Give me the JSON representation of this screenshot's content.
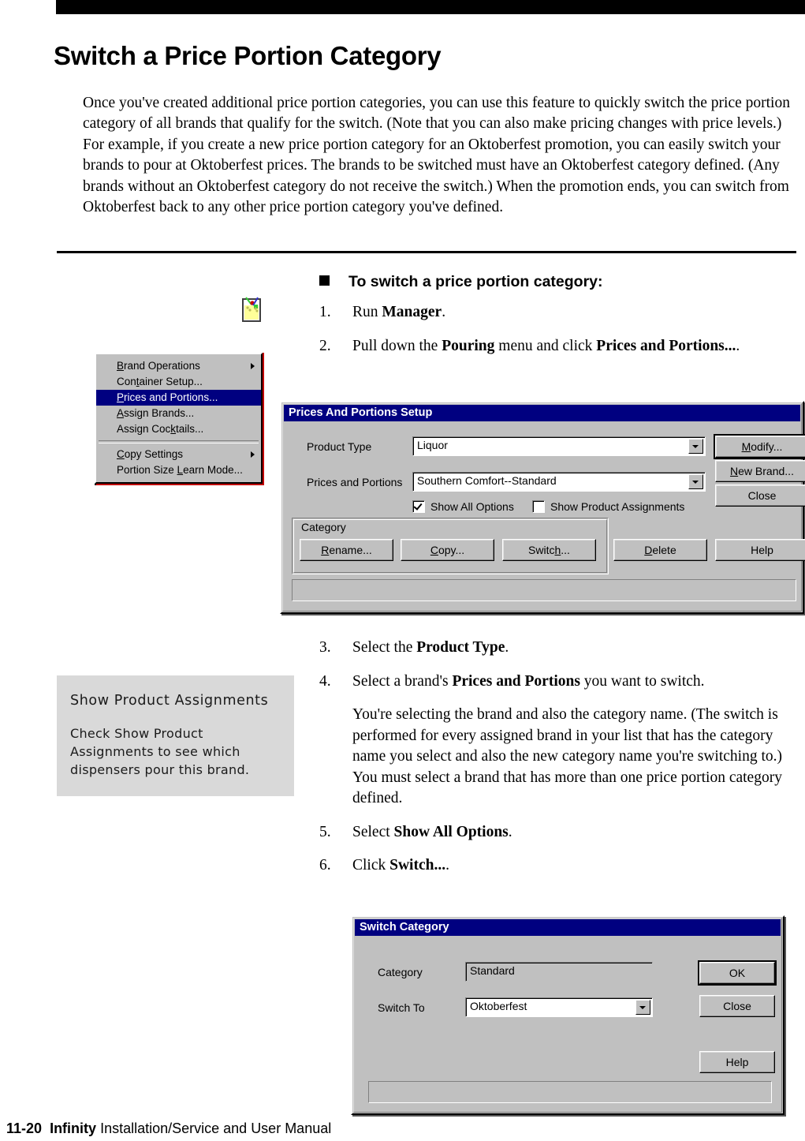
{
  "page": {
    "title": "Switch a Price Portion Category",
    "intro": "Once you've created additional price portion categories, you can use this feature to quickly switch the price portion category of all brands that qualify for the switch. (Note that you can also make pricing changes with price levels.) For example, if you create a new price portion category for an Oktoberfest promotion, you can easily switch your brands to pour at Oktoberfest prices. The brands to be switched must have an Oktoberfest category defined. (Any brands without an Oktoberfest category do not receive the switch.) When the promotion ends, you can switch from Oktoberfest back to any other price portion category you've defined."
  },
  "procedure": {
    "heading": "To switch a price portion category:",
    "steps": [
      {
        "num": "1.",
        "text_before": "Run ",
        "bold": "Manager",
        "text_after": "."
      },
      {
        "num": "2.",
        "text_before": "Pull down the ",
        "bold": "Pouring",
        "text_mid": " menu and click ",
        "bold2": "Prices and Portions...",
        "text_after": "."
      },
      {
        "num": "3.",
        "text_before": "Select the ",
        "bold": "Product Type",
        "text_after": "."
      },
      {
        "num": "4.",
        "text_before": "Select a brand's ",
        "bold": "Prices and Portions",
        "text_after": " you want to switch."
      },
      {
        "num": "5.",
        "text_before": "Select ",
        "bold": "Show All Options",
        "text_after": "."
      },
      {
        "num": "6.",
        "text_before": "Click ",
        "bold": "Switch...",
        "text_after": "."
      }
    ],
    "step4_note": "You're selecting the brand and also the category name. (The switch is performed for every assigned brand in your list that has the category name you select and also the new category name you're switching to.) You must select a brand that has more than one price portion category defined."
  },
  "note_box": {
    "title": "Show Product Assignments",
    "body": "Check Show Product Assignments to see which dispensers pour this brand."
  },
  "pouring_menu": {
    "items": [
      {
        "label": "Brand Operations",
        "accel": "B",
        "submenu": true,
        "selected": false
      },
      {
        "label": "Container Setup...",
        "accel": "t",
        "submenu": false,
        "selected": false
      },
      {
        "label": "Prices and Portions...",
        "accel": "P",
        "submenu": false,
        "selected": true
      },
      {
        "label": "Assign Brands...",
        "accel": "A",
        "submenu": false,
        "selected": false
      },
      {
        "label": "Assign Cocktails...",
        "accel": "k",
        "submenu": false,
        "selected": false
      },
      {
        "separator": true
      },
      {
        "label": "Copy Settings",
        "accel": "C",
        "submenu": true,
        "selected": false
      },
      {
        "label": "Portion Size Learn Mode...",
        "accel": "L",
        "submenu": false,
        "selected": false
      }
    ]
  },
  "prices_dialog": {
    "title": "Prices And Portions Setup",
    "product_type_label": "Product Type",
    "product_type_value": "Liquor",
    "prices_portions_label": "Prices and Portions",
    "prices_portions_value": "Southern Comfort--Standard",
    "show_all_options_label": "Show All Options",
    "show_all_options_checked": true,
    "show_product_assignments_label": "Show Product Assignments",
    "show_product_assignments_checked": false,
    "category_group_label": "Category",
    "buttons": {
      "modify": "Modify...",
      "new_brand": "New Brand...",
      "close": "Close",
      "rename": "Rename...",
      "copy": "Copy...",
      "switch": "Switch...",
      "delete": "Delete",
      "help": "Help"
    },
    "status_text": ""
  },
  "switch_dialog": {
    "title": "Switch Category",
    "category_label": "Category",
    "category_value": "Standard",
    "switch_to_label": "Switch To",
    "switch_to_value": "Oktoberfest",
    "buttons": {
      "ok": "OK",
      "close": "Close",
      "help": "Help"
    },
    "status_text": ""
  },
  "footer": {
    "page_number": "11-20",
    "product": "Infinity",
    "manual": "Installation/Service and User Manual"
  },
  "colors": {
    "title_bar": "#000080",
    "menu_highlight": "#000080",
    "menu_accent": "#c00000",
    "dialog_face": "#c0c0c0",
    "note_box_bg": "#d9d9d9"
  }
}
